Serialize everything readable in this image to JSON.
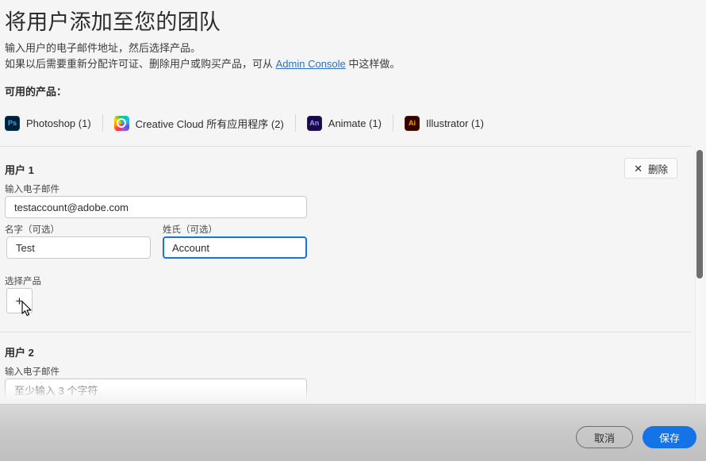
{
  "header": {
    "title": "将用户添加至您的团队",
    "intro_line1": "输入用户的电子邮件地址，然后选择产品。",
    "intro_line2_pre": "如果以后需要重新分配许可证、删除用户或购买产品，可从 ",
    "intro_link": "Admin Console",
    "intro_line2_post": " 中这样做。"
  },
  "available_products": {
    "label": "可用的产品：",
    "items": [
      {
        "icon": "photoshop-icon",
        "icon_text": "Ps",
        "name": "Photoshop (1)"
      },
      {
        "icon": "creative-cloud-icon",
        "icon_text": "",
        "name": "Creative Cloud 所有应用程序 (2)"
      },
      {
        "icon": "animate-icon",
        "icon_text": "An",
        "name": "Animate (1)"
      },
      {
        "icon": "illustrator-icon",
        "icon_text": "Ai",
        "name": "Illustrator (1)"
      }
    ]
  },
  "users": [
    {
      "heading": "用户 1",
      "delete_label": "删除",
      "delete_icon": "close-icon",
      "email_label": "输入电子邮件",
      "email_value": "testaccount@adobe.com",
      "email_placeholder": "至少输入 3 个字符",
      "firstname_label": "名字（可选）",
      "firstname_value": "Test",
      "lastname_label": "姓氏（可选）",
      "lastname_value": "Account",
      "products_label": "选择产品",
      "add_product_icon": "plus-icon",
      "add_product_glyph": "+"
    },
    {
      "heading": "用户 2",
      "email_label": "输入电子邮件",
      "email_value": "",
      "email_placeholder": "至少输入 3 个字符"
    }
  ],
  "footer": {
    "cancel_label": "取消",
    "save_label": "保存"
  },
  "colors": {
    "accent_blue": "#1473e6",
    "link_blue": "#2f6fc0",
    "page_bg": "#f5f5f5",
    "footer_bg": "#c9c9c9",
    "border": "#cacaca",
    "divider": "#e1e1e1"
  }
}
